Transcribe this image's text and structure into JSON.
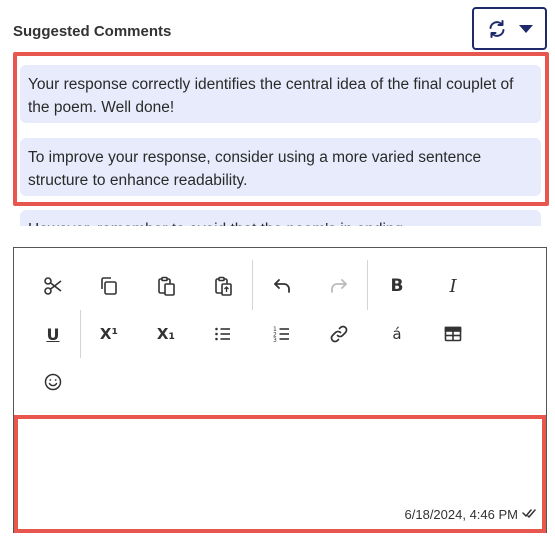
{
  "header": {
    "title": "Suggested Comments"
  },
  "refresh_control": {
    "icon": "refresh-icon",
    "dropdown_icon": "caret-down-icon",
    "accent_color": "#1f2a6b"
  },
  "suggestions": [
    {
      "text": "Your response correctly identifies the central idea of the final couplet of the poem. Well done!"
    },
    {
      "text": "To improve your response, consider using a more varied sentence structure to enhance readability."
    },
    {
      "text": "However, remember to avoid that the poem's in ending."
    }
  ],
  "highlight_color": "#e8574f",
  "editor": {
    "toolbar_row1": [
      "scissors-icon",
      "copy-icon",
      "paste-icon",
      "paste-special-icon",
      "undo-icon",
      "redo-icon",
      "bold-icon",
      "italic-icon"
    ],
    "toolbar_row2": [
      "underline-icon",
      "superscript-icon",
      "subscript-icon",
      "bulleted-list-icon",
      "numbered-list-icon",
      "link-icon",
      "special-character-icon",
      "table-icon"
    ],
    "toolbar_row3": [
      "emoji-icon"
    ],
    "bold_label": "B",
    "italic_label": "I",
    "underline_label": "U",
    "superscript_label": "X¹",
    "subscript_label": "X₁",
    "special_char_label": "á",
    "body_text": "",
    "timestamp": "6/18/2024, 4:46 PM"
  }
}
